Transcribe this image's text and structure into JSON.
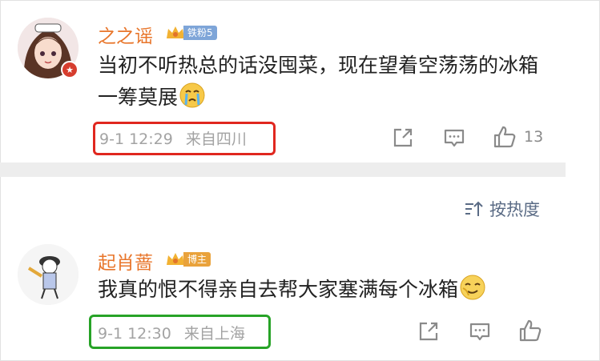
{
  "sort": {
    "label": "按热度"
  },
  "comments": [
    {
      "name": "之之谣",
      "badge": "铁粉5",
      "text": "当初不听热总的话没囤菜，现在望着空荡荡的冰箱一筹莫展",
      "date": "9-1 12:29",
      "source": "来自四川",
      "likes": "13",
      "highlight_color": "#e0271f"
    },
    {
      "name": "起肖蔷",
      "badge": "博主",
      "text": "我真的恨不得亲自去帮大家塞满每个冰箱",
      "date": "9-1 12:30",
      "source": "来自上海",
      "likes": "",
      "highlight_color": "#27a327"
    }
  ],
  "icons": [
    "share-icon",
    "comment-icon",
    "like-icon",
    "crying-emoji-icon",
    "smirk-emoji-icon",
    "sort-icon",
    "crown-icon"
  ],
  "colors": {
    "username": "#e8752a",
    "meta": "#a3a3a3",
    "badge_fan": "#7ea5d8",
    "badge_blogger": "#e9a23b"
  }
}
